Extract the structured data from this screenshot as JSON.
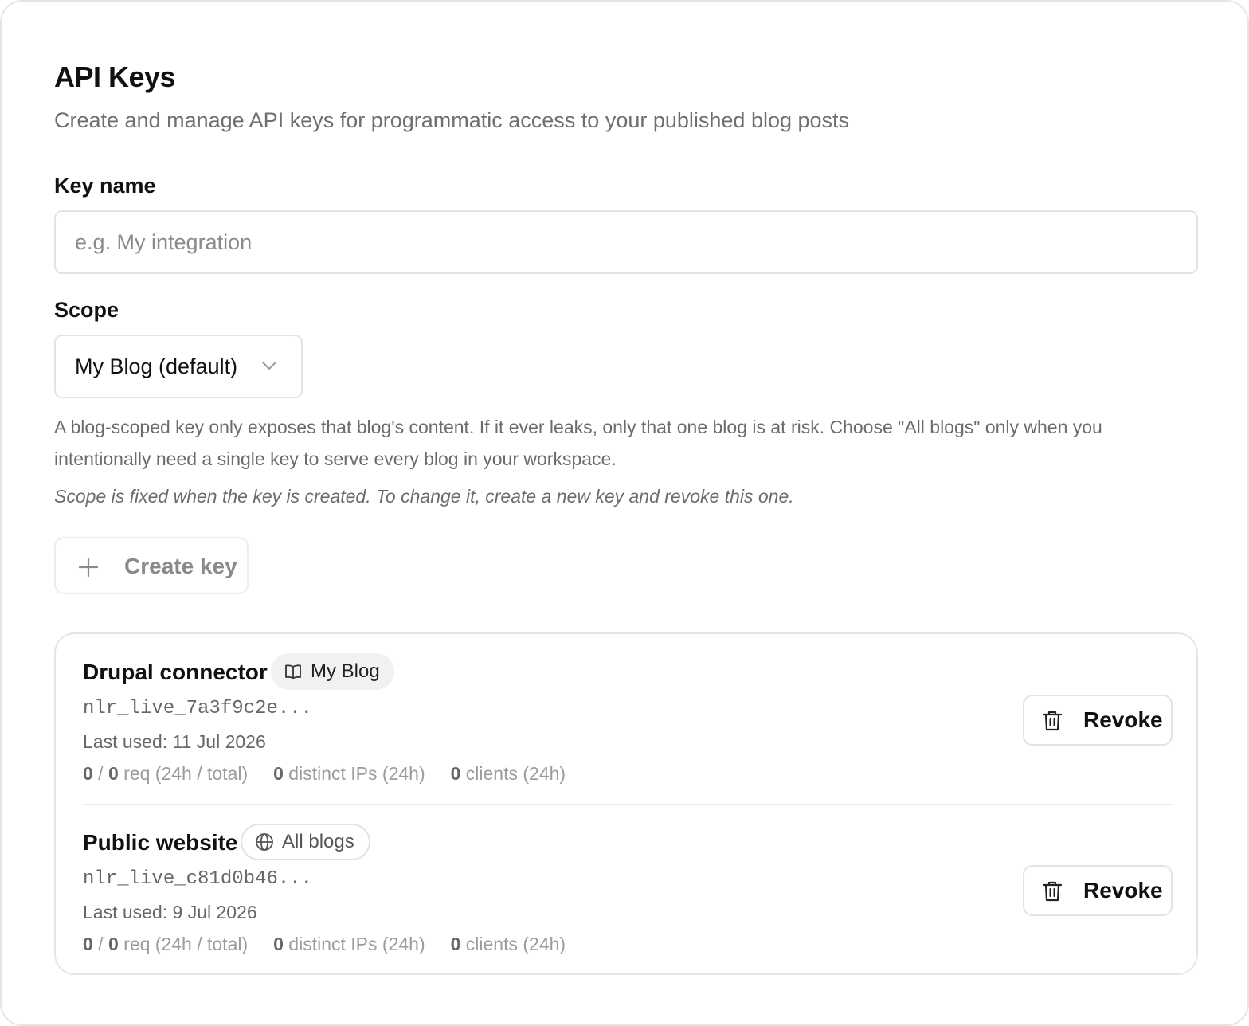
{
  "header": {
    "title": "API Keys",
    "subtitle": "Create and manage API keys for programmatic access to your published blog posts"
  },
  "form": {
    "key_name_label": "Key name",
    "key_name_placeholder": "e.g. My integration",
    "key_name_value": "",
    "scope_label": "Scope",
    "scope_selected": "My Blog (default)",
    "scope_help": "A blog-scoped key only exposes that blog's content. If it ever leaks, only that one blog is at risk. Choose \"All blogs\" only when you intentionally need a single key to serve every blog in your workspace.",
    "scope_note": "Scope is fixed when the key is created. To change it, create a new key and revoke this one.",
    "create_label": "Create key",
    "create_icon": "plus-icon"
  },
  "keys": [
    {
      "name": "Drupal connector",
      "scope_badge": "My Blog",
      "scope_icon": "book-icon",
      "prefix": "nlr_live_7a3f9c2e...",
      "last_used": "Last used: 11 Jul 2026",
      "req_24h": "0",
      "req_sep": " / ",
      "req_total": "0",
      "req_label": " req (24h / total)",
      "ips": "0",
      "ips_label": " distinct IPs (24h)",
      "clients": "0",
      "clients_label": " clients (24h)",
      "revoke_label": "Revoke"
    },
    {
      "name": "Public website",
      "scope_badge": "All blogs",
      "scope_icon": "globe-icon",
      "prefix": "nlr_live_c81d0b46...",
      "last_used": "Last used: 9 Jul 2026",
      "req_24h": "0",
      "req_sep": " / ",
      "req_total": "0",
      "req_label": " req (24h / total)",
      "ips": "0",
      "ips_label": " distinct IPs (24h)",
      "clients": "0",
      "clients_label": " clients (24h)",
      "revoke_label": "Revoke"
    }
  ]
}
